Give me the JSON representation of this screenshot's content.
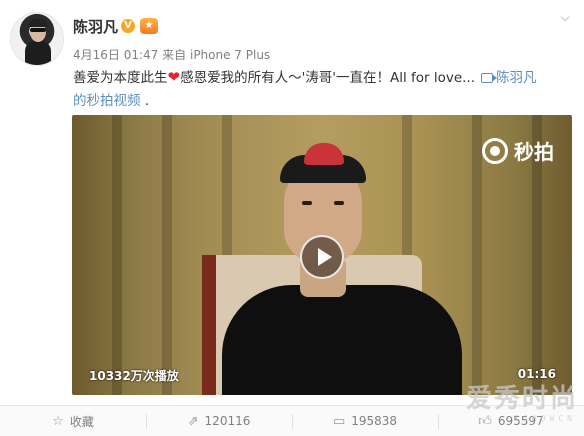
{
  "user": {
    "name": "陈羽凡",
    "verified_badge": "V",
    "medal_icon": "medal-icon"
  },
  "meta": {
    "date": "4月16日 01:47",
    "from_prefix": "来自",
    "source": "iPhone 7 Plus"
  },
  "post": {
    "text_part1": "善爱为本度此生",
    "text_part2": "感恩爱我的所有人～'涛哥'一直在！All for love...",
    "video_link_line1": "陈羽凡",
    "video_link_line2": "的秒拍视频",
    "trailing": " ."
  },
  "video": {
    "brand": "秒拍",
    "views": "10332万次播放",
    "duration": "01:16"
  },
  "actions": {
    "favorite": "收藏",
    "share": "120116",
    "comment": "195838",
    "like": "695597"
  },
  "watermark": {
    "text": "爱秀时尚",
    "sub": "ISHOWCN"
  },
  "colors": {
    "link": "#eb7350",
    "video_link": "#5b8dbf",
    "badge": "#f5a623",
    "heart": "#e3262b"
  }
}
